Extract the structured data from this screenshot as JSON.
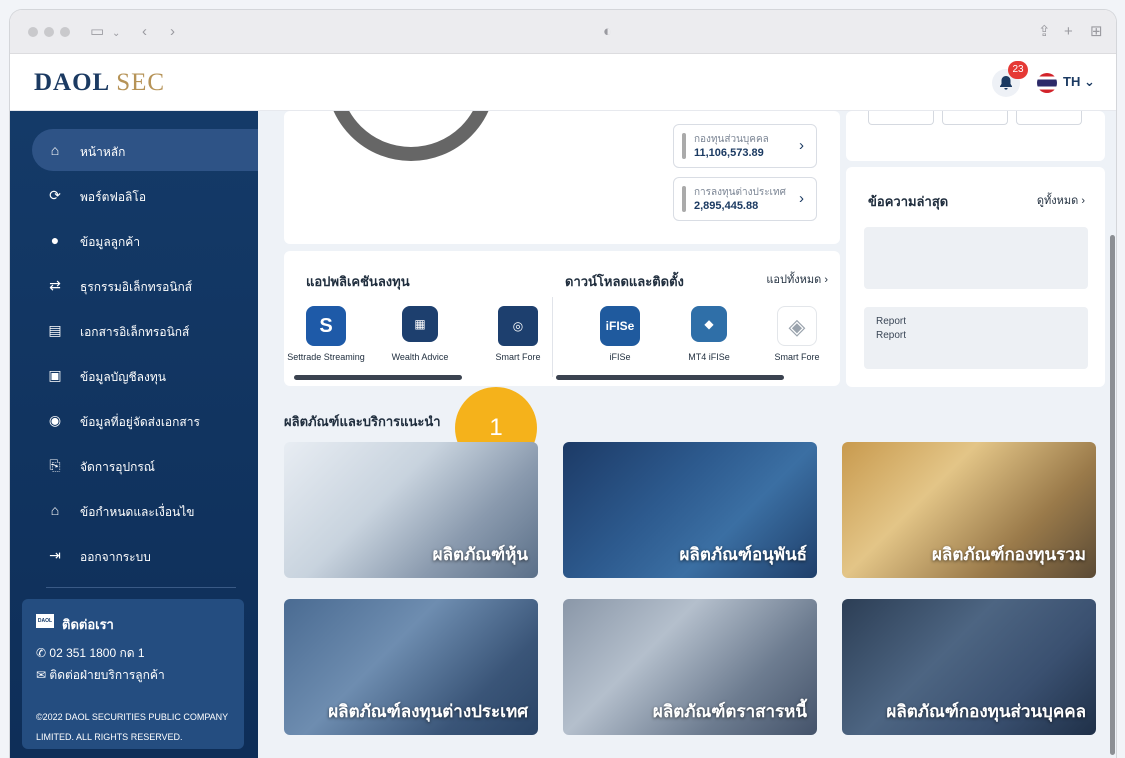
{
  "brand": {
    "part1": "DAOL",
    "part2": "SEC"
  },
  "header": {
    "notification_count": "23",
    "language": "TH"
  },
  "sidebar": {
    "items": [
      {
        "label": "หน้าหลัก",
        "icon": "home-icon"
      },
      {
        "label": "พอร์ตฟอลิโอ",
        "icon": "portfolio-icon"
      },
      {
        "label": "ข้อมูลลูกค้า",
        "icon": "user-icon"
      },
      {
        "label": "ธุรกรรมอิเล็กทรอนิกส์",
        "icon": "transaction-icon"
      },
      {
        "label": "เอกสารอิเล็กทรอนิกส์",
        "icon": "document-icon"
      },
      {
        "label": "ข้อมูลบัญชีลงทุน",
        "icon": "account-icon"
      },
      {
        "label": "ข้อมูลที่อยู่จัดส่งเอกสาร",
        "icon": "location-icon"
      },
      {
        "label": "จัดการอุปกรณ์",
        "icon": "device-icon"
      },
      {
        "label": "ข้อกำหนดและเงื่อนไข",
        "icon": "terms-icon"
      },
      {
        "label": "ออกจากระบบ",
        "icon": "logout-icon"
      }
    ],
    "contact": {
      "title": "ติดต่อเรา",
      "logo_text": "DAOL",
      "phone": "02 351 1800 กด 1",
      "service": "ติดต่อฝ่ายบริการลูกค้า",
      "copyright": "©2022 DAOL SECURITIES PUBLIC COMPANY LIMITED. ALL RIGHTS RESERVED."
    }
  },
  "funds": [
    {
      "name": "กองทุนส่วนบุคคล",
      "value": "11,106,573.89"
    },
    {
      "name": "การลงทุนต่างประเทศ",
      "value": "2,895,445.88"
    }
  ],
  "apps": {
    "title": "แอปพลิเคชันลงทุน",
    "download_title": "ดาวน์โหลดและติดตั้ง",
    "view_all": "แอปทั้งหมด",
    "items": [
      {
        "label": "Settrade Streaming",
        "color": "#1e5aa8"
      },
      {
        "label": "Wealth Advice",
        "color": "#1d3f6e"
      },
      {
        "label": "Smart Fore",
        "color": "#1d3f6e"
      },
      {
        "label": "iFISe",
        "color": "#1f5a9e",
        "icon_text": "iFISe"
      },
      {
        "label": "MT4 iFISe",
        "color": "#2f6fa8"
      },
      {
        "label": "Smart Fore",
        "color": "#9aa3ad"
      }
    ]
  },
  "messages": {
    "title": "ข้อความล่าสุด",
    "view_all": "ดูทั้งหมด",
    "report_title": "Report",
    "report_body": "Report"
  },
  "products": {
    "title": "ผลิตภัณฑ์และบริการแนะนำ",
    "step_number": "1",
    "tiles": [
      {
        "label": "ผลิตภัณฑ์หุ้น"
      },
      {
        "label": "ผลิตภัณฑ์อนุพันธ์"
      },
      {
        "label": "ผลิตภัณฑ์กองทุนรวม"
      },
      {
        "label": "ผลิตภัณฑ์ลงทุนต่างประเทศ"
      },
      {
        "label": "ผลิตภัณฑ์ตราสารหนี้"
      },
      {
        "label": "ผลิตภัณฑ์กองทุนส่วนบุคคล"
      }
    ]
  },
  "colors": {
    "primary": "#143a68",
    "accent": "#b69357",
    "step": "#f5b21b",
    "badge": "#e53935"
  }
}
